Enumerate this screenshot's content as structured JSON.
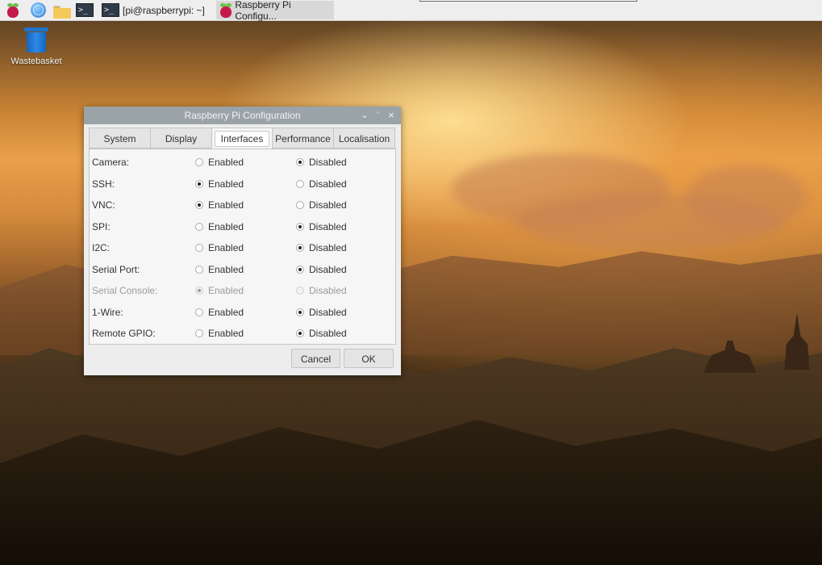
{
  "taskbar": {
    "menu_icon": "raspberry-pi-icon",
    "browser_icon": "globe-icon",
    "files_icon": "folder-icon",
    "terminal_icon": "terminal-icon",
    "tasks": [
      {
        "label": "[pi@raspberrypi: ~]",
        "icon": "terminal-icon",
        "active": false
      },
      {
        "label": "Raspberry Pi Configu...",
        "icon": "raspberry-pi-icon",
        "active": true
      }
    ]
  },
  "desktop": {
    "wastebasket_label": "Wastebasket",
    "wastebasket_icon": "trash-icon"
  },
  "dialog": {
    "title": "Raspberry Pi Configuration",
    "controls": {
      "minimize": "⌄",
      "maximize": "⌃",
      "close": "×"
    },
    "tabs": [
      "System",
      "Display",
      "Interfaces",
      "Performance",
      "Localisation"
    ],
    "active_tab": "Interfaces",
    "option_labels": {
      "enabled": "Enabled",
      "disabled": "Disabled"
    },
    "interfaces": [
      {
        "name": "Camera:",
        "value": "Disabled",
        "sensitive": true
      },
      {
        "name": "SSH:",
        "value": "Enabled",
        "sensitive": true
      },
      {
        "name": "VNC:",
        "value": "Enabled",
        "sensitive": true
      },
      {
        "name": "SPI:",
        "value": "Disabled",
        "sensitive": true
      },
      {
        "name": "I2C:",
        "value": "Disabled",
        "sensitive": true
      },
      {
        "name": "Serial Port:",
        "value": "Disabled",
        "sensitive": true
      },
      {
        "name": "Serial Console:",
        "value": "Enabled",
        "sensitive": false
      },
      {
        "name": "1-Wire:",
        "value": "Disabled",
        "sensitive": true
      },
      {
        "name": "Remote GPIO:",
        "value": "Disabled",
        "sensitive": true
      }
    ],
    "buttons": {
      "cancel": "Cancel",
      "ok": "OK"
    }
  },
  "colors": {
    "titlebar": "#9aa3a8",
    "dialog_bg": "#ededed",
    "taskbar_bg": "#eeeeee",
    "raspberry": "#c51a4a"
  }
}
